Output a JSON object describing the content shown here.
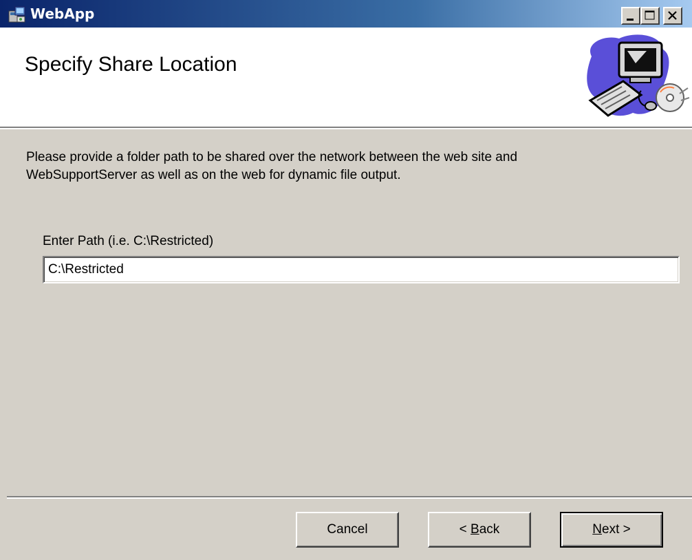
{
  "window": {
    "title": "WebApp",
    "icon": "installer-icon",
    "caption_buttons": [
      "minimize",
      "maximize",
      "close"
    ]
  },
  "banner": {
    "title": "Specify Share Location",
    "graphic": "computer-with-cd-icon"
  },
  "content": {
    "description_line1": "Please provide a folder path to be shared over the network between the web site and",
    "description_line2": "WebSupportServer as well as on the web for dynamic file output.",
    "path_label": "Enter Path (i.e. C:\\Restricted)",
    "path_value": "C:\\Restricted"
  },
  "buttons": {
    "cancel": "Cancel",
    "back_prefix": "< ",
    "back_mnemonic": "B",
    "back_rest": "ack",
    "next_mnemonic": "N",
    "next_rest": "ext >"
  },
  "colors": {
    "dialog_bg": "#d4d0c8",
    "titlebar_start": "#0a246a",
    "titlebar_end": "#a6caf0",
    "banner_bg": "#ffffff"
  }
}
